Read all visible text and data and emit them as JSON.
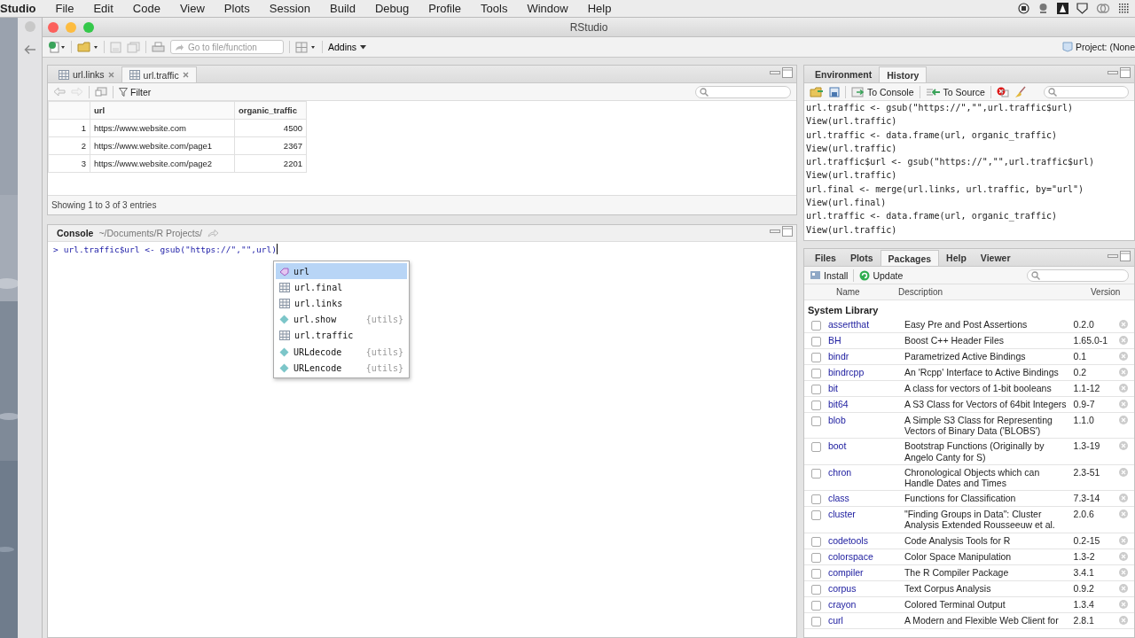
{
  "menubar": {
    "app": "Studio",
    "items": [
      "File",
      "Edit",
      "Code",
      "View",
      "Plots",
      "Session",
      "Build",
      "Debug",
      "Profile",
      "Tools",
      "Window",
      "Help"
    ]
  },
  "window": {
    "title": "RStudio"
  },
  "toolbar": {
    "goto_placeholder": "Go to file/function",
    "addins": "Addins",
    "project": "Project: (None"
  },
  "source": {
    "tabs": [
      {
        "label": "url.links",
        "selected": false
      },
      {
        "label": "url.traffic",
        "selected": true
      }
    ],
    "filter": "Filter",
    "columns": [
      "url",
      "organic_traffic"
    ],
    "rows": [
      {
        "index": "1",
        "url": "https://www.website.com",
        "organic_traffic": "4500"
      },
      {
        "index": "2",
        "url": "https://www.website.com/page1",
        "organic_traffic": "2367"
      },
      {
        "index": "3",
        "url": "https://www.website.com/page2",
        "organic_traffic": "2201"
      }
    ],
    "footer": "Showing 1 to 3 of 3 entries"
  },
  "console": {
    "title": "Console",
    "path": "~/Documents/R Projects/",
    "prompt": ">",
    "input": "url.traffic$url <- gsub(\"https://\",\"\",url)",
    "completions": [
      {
        "label": "url",
        "kind": "value",
        "selected": true
      },
      {
        "label": "url.final",
        "kind": "data",
        "selected": false
      },
      {
        "label": "url.links",
        "kind": "data",
        "selected": false
      },
      {
        "label": "url.show",
        "kind": "function",
        "package": "{utils}",
        "selected": false
      },
      {
        "label": "url.traffic",
        "kind": "data",
        "selected": false
      },
      {
        "label": "URLdecode",
        "kind": "function",
        "package": "{utils}",
        "selected": false
      },
      {
        "label": "URLencode",
        "kind": "function",
        "package": "{utils}",
        "selected": false
      }
    ]
  },
  "environment": {
    "tabs": [
      {
        "label": "Environment",
        "selected": false
      },
      {
        "label": "History",
        "selected": true
      }
    ],
    "buttons": [
      "To Console",
      "To Source"
    ],
    "history": [
      "url.traffic <- gsub(\"https://\",\"\",url.traffic$url)",
      "View(url.traffic)",
      "url.traffic <- data.frame(url, organic_traffic)",
      "View(url.traffic)",
      "url.traffic$url <- gsub(\"https://\",\"\",url.traffic$url)",
      "View(url.traffic)",
      "url.final <- merge(url.links, url.traffic, by=\"url\")",
      "View(url.final)",
      "url.traffic <- data.frame(url, organic_traffic)",
      "View(url.traffic)"
    ]
  },
  "files": {
    "tabs": [
      {
        "label": "Files",
        "selected": false
      },
      {
        "label": "Plots",
        "selected": false
      },
      {
        "label": "Packages",
        "selected": true
      },
      {
        "label": "Help",
        "selected": false
      },
      {
        "label": "Viewer",
        "selected": false
      }
    ],
    "buttons": [
      "Install",
      "Update"
    ],
    "columns": [
      "Name",
      "Description",
      "Version"
    ],
    "group": "System Library",
    "packages": [
      {
        "name": "assertthat",
        "description": "Easy Pre and Post Assertions",
        "version": "0.2.0",
        "checked": false
      },
      {
        "name": "BH",
        "description": "Boost C++ Header Files",
        "version": "1.65.0-1",
        "checked": false
      },
      {
        "name": "bindr",
        "description": "Parametrized Active Bindings",
        "version": "0.1",
        "checked": false
      },
      {
        "name": "bindrcpp",
        "description": "An 'Rcpp' Interface to Active Bindings",
        "version": "0.2",
        "checked": false
      },
      {
        "name": "bit",
        "description": "A class for vectors of 1-bit booleans",
        "version": "1.1-12",
        "checked": false
      },
      {
        "name": "bit64",
        "description": "A S3 Class for Vectors of 64bit Integers",
        "version": "0.9-7",
        "checked": false
      },
      {
        "name": "blob",
        "description": "A Simple S3 Class for Representing Vectors of Binary Data ('BLOBS')",
        "version": "1.1.0",
        "checked": false
      },
      {
        "name": "boot",
        "description": "Bootstrap Functions (Originally by Angelo Canty for S)",
        "version": "1.3-19",
        "checked": false
      },
      {
        "name": "chron",
        "description": "Chronological Objects which can Handle Dates and Times",
        "version": "2.3-51",
        "checked": false
      },
      {
        "name": "class",
        "description": "Functions for Classification",
        "version": "7.3-14",
        "checked": false
      },
      {
        "name": "cluster",
        "description": "\"Finding Groups in Data\": Cluster Analysis Extended Rousseeuw et al.",
        "version": "2.0.6",
        "checked": false
      },
      {
        "name": "codetools",
        "description": "Code Analysis Tools for R",
        "version": "0.2-15",
        "checked": false
      },
      {
        "name": "colorspace",
        "description": "Color Space Manipulation",
        "version": "1.3-2",
        "checked": false
      },
      {
        "name": "compiler",
        "description": "The R Compiler Package",
        "version": "3.4.1",
        "checked": false
      },
      {
        "name": "corpus",
        "description": "Text Corpus Analysis",
        "version": "0.9.2",
        "checked": false
      },
      {
        "name": "crayon",
        "description": "Colored Terminal Output",
        "version": "1.3.4",
        "checked": false
      },
      {
        "name": "curl",
        "description": "A Modern and Flexible Web Client for",
        "version": "2.8.1",
        "checked": false
      }
    ]
  }
}
